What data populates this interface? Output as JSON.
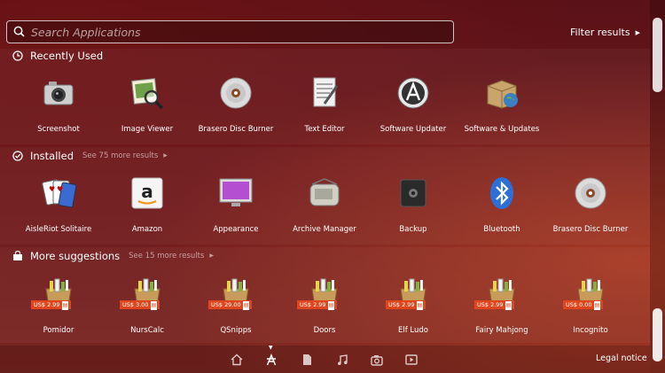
{
  "search": {
    "placeholder": "Search Applications"
  },
  "filter": {
    "label": "Filter results"
  },
  "sections": [
    {
      "title": "Recently Used",
      "more": ""
    },
    {
      "title": "Installed",
      "more": "See 75 more results"
    },
    {
      "title": "More suggestions",
      "more": "See 15 more results"
    }
  ],
  "recent": [
    {
      "label": "Screenshot",
      "icon": "camera-icon"
    },
    {
      "label": "Image Viewer",
      "icon": "image-viewer-icon"
    },
    {
      "label": "Brasero Disc Burner",
      "icon": "disc-icon"
    },
    {
      "label": "Text Editor",
      "icon": "text-editor-icon"
    },
    {
      "label": "Software Updater",
      "icon": "updater-icon"
    },
    {
      "label": "Software & Updates",
      "icon": "box-globe-icon"
    }
  ],
  "installed": [
    {
      "label": "AisleRiot Solitaire",
      "icon": "cards-icon"
    },
    {
      "label": "Amazon",
      "icon": "amazon-icon"
    },
    {
      "label": "Appearance",
      "icon": "monitor-icon"
    },
    {
      "label": "Archive Manager",
      "icon": "archive-icon"
    },
    {
      "label": "Backup",
      "icon": "safe-icon"
    },
    {
      "label": "Bluetooth",
      "icon": "bluetooth-icon"
    },
    {
      "label": "Brasero Disc Burner",
      "icon": "disc-icon"
    }
  ],
  "suggestions": [
    {
      "label": "Pomidor",
      "price": "US$ 2.99"
    },
    {
      "label": "NursCalc",
      "price": "US$ 3.00"
    },
    {
      "label": "QSnipps",
      "price": "US$ 29.00"
    },
    {
      "label": "Doors",
      "price": "US$ 2.99"
    },
    {
      "label": "Elf Ludo",
      "price": "US$ 2.99"
    },
    {
      "label": "Fairy Mahjong",
      "price": "US$ 2.99"
    },
    {
      "label": "Incognito",
      "price": "US$ 0.00"
    }
  ],
  "bottom": {
    "legal": "Legal notice"
  },
  "colors": {
    "accent": "#e0461e",
    "bg": "#6b1a1f"
  }
}
